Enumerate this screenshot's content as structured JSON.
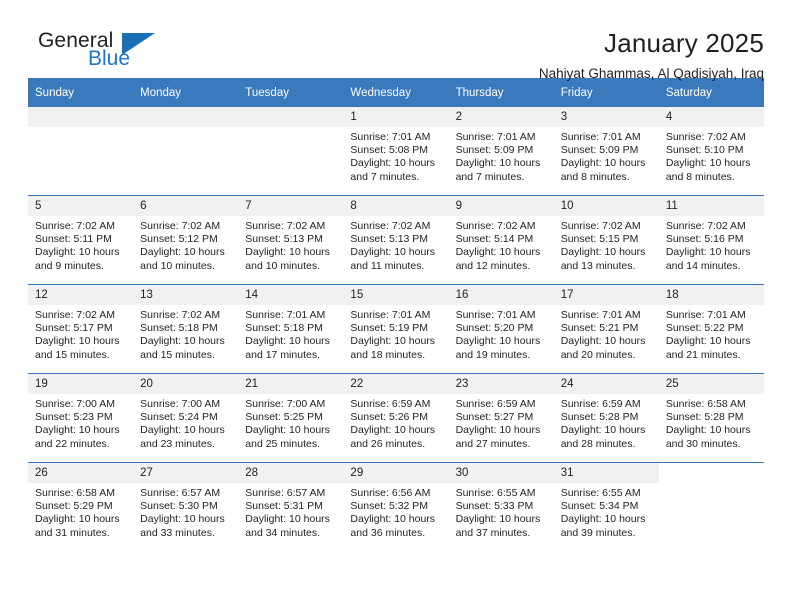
{
  "brand": {
    "name_top": "General",
    "name_bottom": "Blue",
    "triangle_color": "#1a6fb5",
    "blue_text_color": "#2076c4"
  },
  "header": {
    "title": "January 2025",
    "subtitle": "Nahiyat Ghammas, Al Qadisiyah, Iraq"
  },
  "theme": {
    "header_bg": "#3a79bb",
    "daynum_bg": "#f1f1f1",
    "text": "#231f20"
  },
  "calendar": {
    "weekday_headers": [
      "Sunday",
      "Monday",
      "Tuesday",
      "Wednesday",
      "Thursday",
      "Friday",
      "Saturday"
    ],
    "weeks": [
      [
        {
          "day": "",
          "blank": true
        },
        {
          "day": "",
          "blank": true
        },
        {
          "day": "",
          "blank": true
        },
        {
          "day": "1",
          "sunrise": "Sunrise: 7:01 AM",
          "sunset": "Sunset: 5:08 PM",
          "daylight": "Daylight: 10 hours and 7 minutes."
        },
        {
          "day": "2",
          "sunrise": "Sunrise: 7:01 AM",
          "sunset": "Sunset: 5:09 PM",
          "daylight": "Daylight: 10 hours and 7 minutes."
        },
        {
          "day": "3",
          "sunrise": "Sunrise: 7:01 AM",
          "sunset": "Sunset: 5:09 PM",
          "daylight": "Daylight: 10 hours and 8 minutes."
        },
        {
          "day": "4",
          "sunrise": "Sunrise: 7:02 AM",
          "sunset": "Sunset: 5:10 PM",
          "daylight": "Daylight: 10 hours and 8 minutes."
        }
      ],
      [
        {
          "day": "5",
          "sunrise": "Sunrise: 7:02 AM",
          "sunset": "Sunset: 5:11 PM",
          "daylight": "Daylight: 10 hours and 9 minutes."
        },
        {
          "day": "6",
          "sunrise": "Sunrise: 7:02 AM",
          "sunset": "Sunset: 5:12 PM",
          "daylight": "Daylight: 10 hours and 10 minutes."
        },
        {
          "day": "7",
          "sunrise": "Sunrise: 7:02 AM",
          "sunset": "Sunset: 5:13 PM",
          "daylight": "Daylight: 10 hours and 10 minutes."
        },
        {
          "day": "8",
          "sunrise": "Sunrise: 7:02 AM",
          "sunset": "Sunset: 5:13 PM",
          "daylight": "Daylight: 10 hours and 11 minutes."
        },
        {
          "day": "9",
          "sunrise": "Sunrise: 7:02 AM",
          "sunset": "Sunset: 5:14 PM",
          "daylight": "Daylight: 10 hours and 12 minutes."
        },
        {
          "day": "10",
          "sunrise": "Sunrise: 7:02 AM",
          "sunset": "Sunset: 5:15 PM",
          "daylight": "Daylight: 10 hours and 13 minutes."
        },
        {
          "day": "11",
          "sunrise": "Sunrise: 7:02 AM",
          "sunset": "Sunset: 5:16 PM",
          "daylight": "Daylight: 10 hours and 14 minutes."
        }
      ],
      [
        {
          "day": "12",
          "sunrise": "Sunrise: 7:02 AM",
          "sunset": "Sunset: 5:17 PM",
          "daylight": "Daylight: 10 hours and 15 minutes."
        },
        {
          "day": "13",
          "sunrise": "Sunrise: 7:02 AM",
          "sunset": "Sunset: 5:18 PM",
          "daylight": "Daylight: 10 hours and 15 minutes."
        },
        {
          "day": "14",
          "sunrise": "Sunrise: 7:01 AM",
          "sunset": "Sunset: 5:18 PM",
          "daylight": "Daylight: 10 hours and 17 minutes."
        },
        {
          "day": "15",
          "sunrise": "Sunrise: 7:01 AM",
          "sunset": "Sunset: 5:19 PM",
          "daylight": "Daylight: 10 hours and 18 minutes."
        },
        {
          "day": "16",
          "sunrise": "Sunrise: 7:01 AM",
          "sunset": "Sunset: 5:20 PM",
          "daylight": "Daylight: 10 hours and 19 minutes."
        },
        {
          "day": "17",
          "sunrise": "Sunrise: 7:01 AM",
          "sunset": "Sunset: 5:21 PM",
          "daylight": "Daylight: 10 hours and 20 minutes."
        },
        {
          "day": "18",
          "sunrise": "Sunrise: 7:01 AM",
          "sunset": "Sunset: 5:22 PM",
          "daylight": "Daylight: 10 hours and 21 minutes."
        }
      ],
      [
        {
          "day": "19",
          "sunrise": "Sunrise: 7:00 AM",
          "sunset": "Sunset: 5:23 PM",
          "daylight": "Daylight: 10 hours and 22 minutes."
        },
        {
          "day": "20",
          "sunrise": "Sunrise: 7:00 AM",
          "sunset": "Sunset: 5:24 PM",
          "daylight": "Daylight: 10 hours and 23 minutes."
        },
        {
          "day": "21",
          "sunrise": "Sunrise: 7:00 AM",
          "sunset": "Sunset: 5:25 PM",
          "daylight": "Daylight: 10 hours and 25 minutes."
        },
        {
          "day": "22",
          "sunrise": "Sunrise: 6:59 AM",
          "sunset": "Sunset: 5:26 PM",
          "daylight": "Daylight: 10 hours and 26 minutes."
        },
        {
          "day": "23",
          "sunrise": "Sunrise: 6:59 AM",
          "sunset": "Sunset: 5:27 PM",
          "daylight": "Daylight: 10 hours and 27 minutes."
        },
        {
          "day": "24",
          "sunrise": "Sunrise: 6:59 AM",
          "sunset": "Sunset: 5:28 PM",
          "daylight": "Daylight: 10 hours and 28 minutes."
        },
        {
          "day": "25",
          "sunrise": "Sunrise: 6:58 AM",
          "sunset": "Sunset: 5:28 PM",
          "daylight": "Daylight: 10 hours and 30 minutes."
        }
      ],
      [
        {
          "day": "26",
          "sunrise": "Sunrise: 6:58 AM",
          "sunset": "Sunset: 5:29 PM",
          "daylight": "Daylight: 10 hours and 31 minutes."
        },
        {
          "day": "27",
          "sunrise": "Sunrise: 6:57 AM",
          "sunset": "Sunset: 5:30 PM",
          "daylight": "Daylight: 10 hours and 33 minutes."
        },
        {
          "day": "28",
          "sunrise": "Sunrise: 6:57 AM",
          "sunset": "Sunset: 5:31 PM",
          "daylight": "Daylight: 10 hours and 34 minutes."
        },
        {
          "day": "29",
          "sunrise": "Sunrise: 6:56 AM",
          "sunset": "Sunset: 5:32 PM",
          "daylight": "Daylight: 10 hours and 36 minutes."
        },
        {
          "day": "30",
          "sunrise": "Sunrise: 6:55 AM",
          "sunset": "Sunset: 5:33 PM",
          "daylight": "Daylight: 10 hours and 37 minutes."
        },
        {
          "day": "31",
          "sunrise": "Sunrise: 6:55 AM",
          "sunset": "Sunset: 5:34 PM",
          "daylight": "Daylight: 10 hours and 39 minutes."
        },
        {
          "day": "",
          "empty_tail": true
        }
      ]
    ]
  }
}
